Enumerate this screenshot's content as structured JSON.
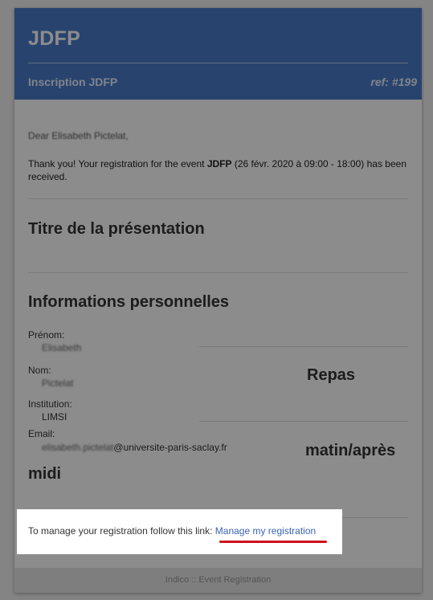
{
  "header": {
    "brand": "JDFP",
    "subtitle": "Inscription JDFP",
    "ref": "ref: #199"
  },
  "body": {
    "greeting": "Dear Elisabeth Pictelat,",
    "message_prefix": "Thank you! Your registration for the event ",
    "event_name": "JDFP",
    "message_suffix": " (26 févr. 2020 à 09:00 - 18:00) has been received."
  },
  "sections": {
    "presentation_title": "Titre de la présentation",
    "personal_info_title": "Informations personnelles"
  },
  "fields": [
    {
      "label": "Prénom:",
      "value": "Elisabeth"
    },
    {
      "label": "Nom:",
      "value": "Pictelat"
    },
    {
      "label": "Institution:",
      "value": "LIMSI"
    },
    {
      "label": "Email:",
      "value_blurred": "elisabeth.pictelat",
      "value_domain": "@universite-paris-saclay.fr"
    }
  ],
  "side_labels": {
    "repas": "Repas",
    "matin": "matin/après",
    "midi": "midi"
  },
  "manage": {
    "text": "To manage your registration follow this link: ",
    "link_label": "Manage my registration"
  },
  "footer": {
    "text": "Indico :: Event Registration"
  },
  "colors": {
    "header_bg": "#4a7dc9",
    "link": "#3a64b0",
    "annotation_underline": "#d0101a"
  }
}
